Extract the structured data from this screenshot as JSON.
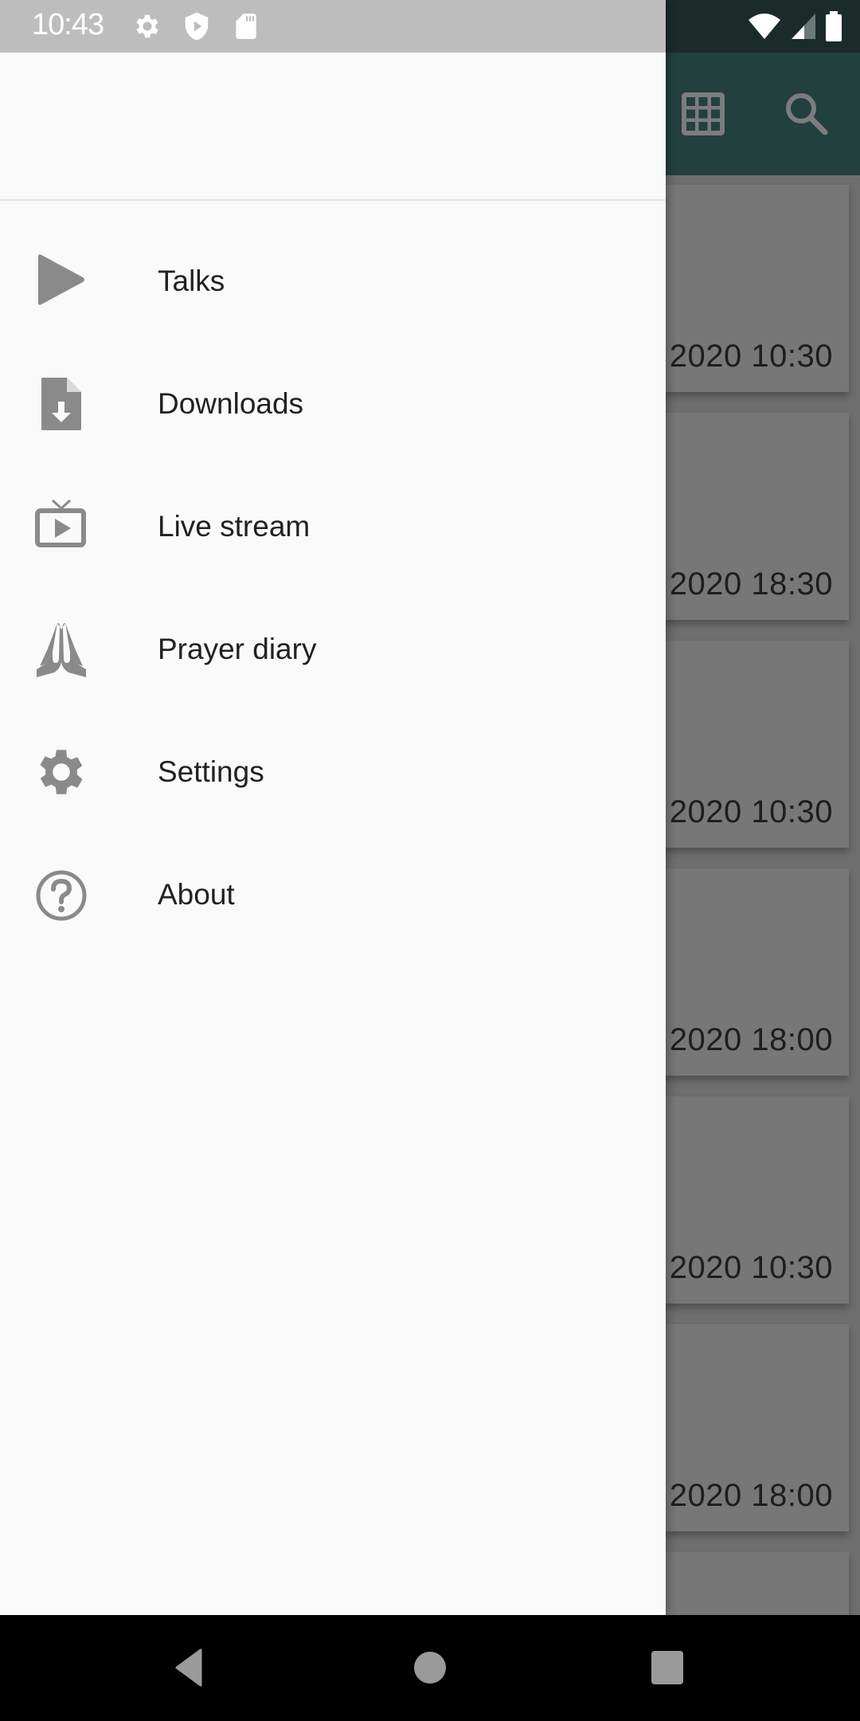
{
  "status_bar": {
    "time": "10:43",
    "left_icons": [
      "settings-icon",
      "play-protect-icon",
      "sd-card-icon"
    ],
    "right_icons": [
      "wifi-icon",
      "cellular-signal-icon",
      "battery-icon"
    ]
  },
  "app_bar": {
    "actions": [
      "grid-view-icon",
      "search-icon"
    ],
    "color": "#22403e"
  },
  "drawer": {
    "items": [
      {
        "label": "Talks",
        "icon": "play-icon"
      },
      {
        "label": "Downloads",
        "icon": "file-download-icon"
      },
      {
        "label": "Live stream",
        "icon": "live-tv-icon"
      },
      {
        "label": "Prayer diary",
        "icon": "praying-hands-icon"
      },
      {
        "label": "Settings",
        "icon": "settings-icon"
      },
      {
        "label": "About",
        "icon": "help-circle-icon"
      }
    ]
  },
  "content": {
    "cards": [
      {
        "date": "2020 10:30"
      },
      {
        "date": "2020 18:30"
      },
      {
        "date": "2020 10:30"
      },
      {
        "date": "2020 18:00"
      },
      {
        "date": "2020 10:30"
      },
      {
        "date": "2020 18:00"
      },
      {
        "date": ""
      }
    ]
  },
  "nav_bar": {
    "buttons": [
      "back",
      "home",
      "recents"
    ]
  }
}
